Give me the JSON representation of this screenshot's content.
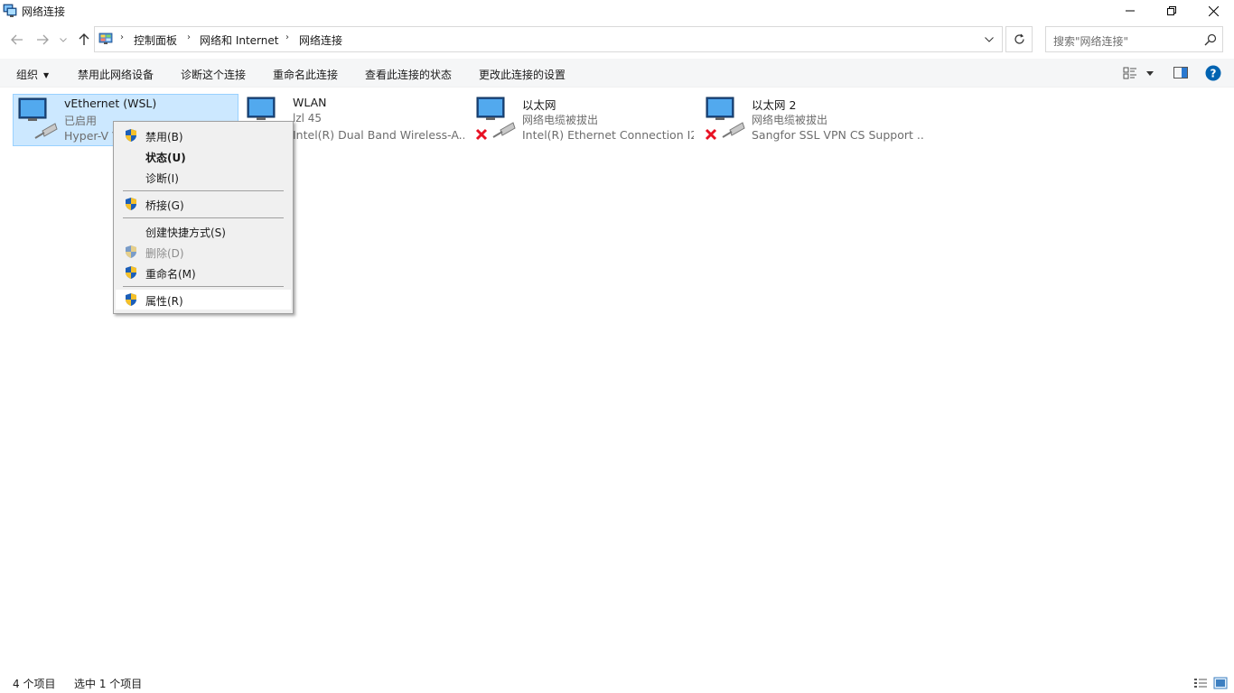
{
  "window": {
    "title": "网络连接",
    "icon": "network-connections-icon"
  },
  "address": {
    "breadcrumbs": [
      "控制面板",
      "网络和 Internet",
      "网络连接"
    ],
    "search_placeholder": "搜索\"网络连接\""
  },
  "toolbar": {
    "organize": "组织",
    "disable": "禁用此网络设备",
    "diagnose": "诊断这个连接",
    "rename": "重命名此连接",
    "view_status": "查看此连接的状态",
    "change_settings": "更改此连接的设置"
  },
  "connections": [
    {
      "name": "vEthernet (WSL)",
      "status": "已启用",
      "device": "Hyper-V Virtual Ethernet Adapter",
      "disconnected": false,
      "selected": true
    },
    {
      "name": "WLAN",
      "status": "lzl 45",
      "device": "Intel(R) Dual Band Wireless-A...",
      "disconnected": false,
      "selected": false
    },
    {
      "name": "以太网",
      "status": "网络电缆被拔出",
      "device": "Intel(R) Ethernet Connection I2...",
      "disconnected": true,
      "selected": false
    },
    {
      "name": "以太网 2",
      "status": "网络电缆被拔出",
      "device": "Sangfor SSL VPN CS Support ...",
      "disconnected": true,
      "selected": false
    }
  ],
  "context_menu": {
    "disable": "禁用(B)",
    "status": "状态(U)",
    "diagnose": "诊断(I)",
    "bridge": "桥接(G)",
    "shortcut": "创建快捷方式(S)",
    "delete": "删除(D)",
    "rename": "重命名(M)",
    "properties": "属性(R)"
  },
  "statusbar": {
    "count": "4 个项目",
    "selected": "选中 1 个项目"
  },
  "colors": {
    "selection": "#cce8ff",
    "selection_border": "#99d1ff",
    "help": "#0063b1",
    "disconnected_x": "#e81123"
  }
}
